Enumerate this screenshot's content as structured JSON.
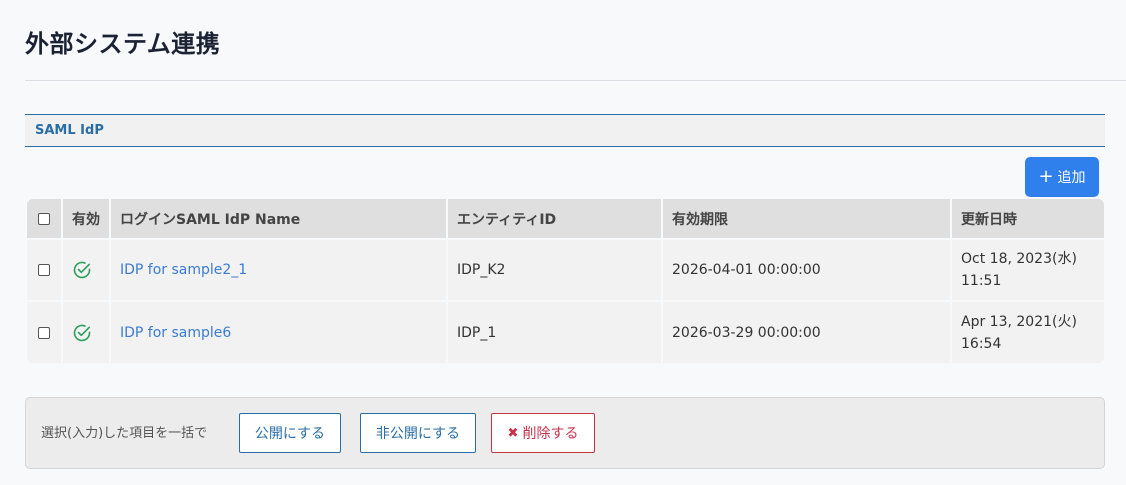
{
  "page": {
    "title": "外部システム連携"
  },
  "section": {
    "label": "SAML IdP"
  },
  "toolbar": {
    "add_label": "追加",
    "add_icon": "plus-icon"
  },
  "table": {
    "headers": {
      "enabled": "有効",
      "name": "ログインSAML IdP Name",
      "entity_id": "エンティティID",
      "expiry": "有効期限",
      "updated": "更新日時"
    },
    "rows": [
      {
        "enabled": true,
        "name": "IDP for sample2_1",
        "entity_id": "IDP_K2",
        "expiry": "2026-04-01 00:00:00",
        "updated_date": "Oct 18, 2023(水)",
        "updated_time": "11:51"
      },
      {
        "enabled": true,
        "name": "IDP for sample6",
        "entity_id": "IDP_1",
        "expiry": "2026-03-29 00:00:00",
        "updated_date": "Apr 13, 2021(火)",
        "updated_time": "16:54"
      }
    ]
  },
  "bulk": {
    "label": "選択(入力)した項目を一括で",
    "publish_label": "公開にする",
    "unpublish_label": "非公開にする",
    "delete_label": "削除する"
  },
  "colors": {
    "primary": "#2f80ed",
    "link": "#3a7bd5",
    "section_accent": "#2a6ea6",
    "enabled_green": "#2e9e5b",
    "danger": "#c7324b"
  }
}
